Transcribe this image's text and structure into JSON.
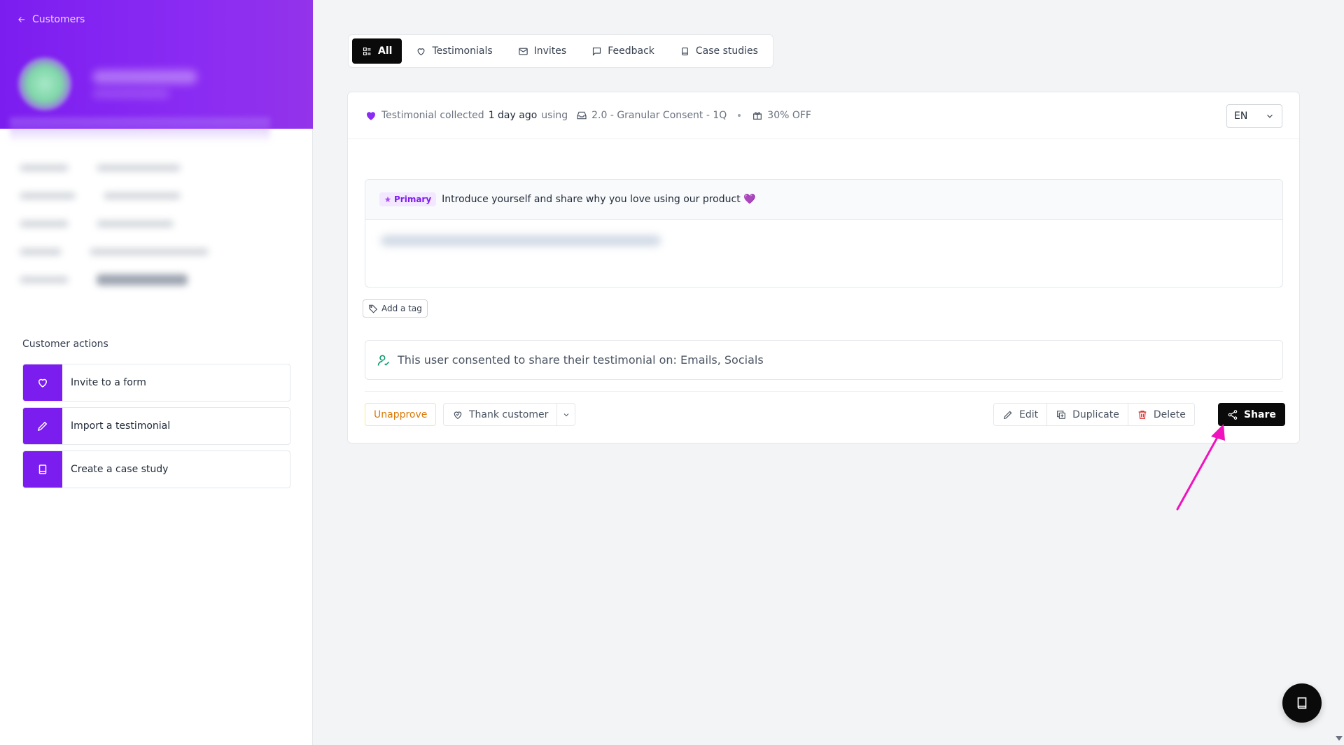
{
  "sidebar": {
    "back_label": "Customers",
    "actions_title": "Customer actions",
    "actions": [
      {
        "label": "Invite to a form",
        "icon": "heart-icon"
      },
      {
        "label": "Import a testimonial",
        "icon": "pencil-icon"
      },
      {
        "label": "Create a case study",
        "icon": "book-icon"
      }
    ]
  },
  "tabs": [
    {
      "label": "All",
      "icon": "grid-list-icon",
      "active": true
    },
    {
      "label": "Testimonials",
      "icon": "heart-icon"
    },
    {
      "label": "Invites",
      "icon": "mail-icon"
    },
    {
      "label": "Feedback",
      "icon": "message-icon"
    },
    {
      "label": "Case studies",
      "icon": "book-icon"
    }
  ],
  "card": {
    "collected_text": "Testimonial collected",
    "time_ago": "1 day ago",
    "using_text": "using",
    "form_name": "2.0 - Granular Consent - 1Q",
    "reward": "30% OFF",
    "language": "EN",
    "question": {
      "badge": "Primary",
      "text": "Introduce yourself and share why you love using our product 💜"
    },
    "add_tag_label": "Add a tag",
    "consent_text": "This user consented to share their testimonial on: Emails, Socials",
    "buttons": {
      "unapprove": "Unapprove",
      "thank": "Thank customer",
      "edit": "Edit",
      "duplicate": "Duplicate",
      "delete": "Delete",
      "share": "Share"
    }
  },
  "colors": {
    "brand_purple": "#7c1df0",
    "share_button": "#0a0a0a",
    "annotation_arrow": "#f012be",
    "unapprove": "#d97706",
    "delete_icon": "#dc2626",
    "consent_icon": "#059669"
  }
}
